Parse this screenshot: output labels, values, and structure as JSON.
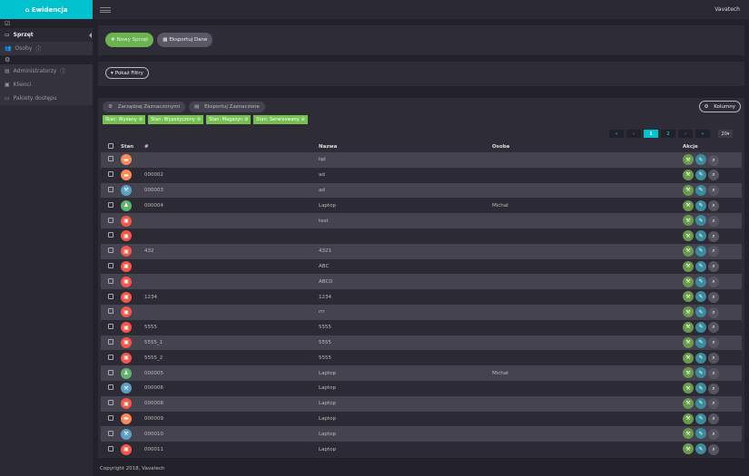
{
  "brand": {
    "title": "Ewidencja",
    "icon": "home-icon"
  },
  "topbar": {
    "user": "Vavatech"
  },
  "sidebar": {
    "items": [
      {
        "label": "Sprzęt",
        "icon": "laptop-icon"
      },
      {
        "label": "Osoby",
        "icon": "users-icon"
      },
      {
        "label": "Administratorzy",
        "icon": "id-card-icon"
      },
      {
        "label": "Klienci",
        "icon": "briefcase-icon"
      },
      {
        "label": "Pakiety dostępu",
        "icon": "credit-card-icon"
      }
    ]
  },
  "toolbar": {
    "new": "Nowy Sprzęt",
    "export": "Eksportuj Dane",
    "filters": "Pokaż Filtry"
  },
  "table_tools": {
    "manage": "Zarządzaj Zaznaczonymi",
    "export_selected": "Eksportuj Zaznaczone",
    "columns": "Kolumny"
  },
  "tags": [
    "Stan: Wydany",
    "Stan: Wypożyczony",
    "Stan: Magazyn",
    "Stan: Serwisowany"
  ],
  "pagination": {
    "pages": [
      "1",
      "2"
    ],
    "current": "1",
    "page_size": "20"
  },
  "columns": {
    "stan": "Stan",
    "num": "#",
    "nazwa": "Nazwa",
    "osoba": "Osoba",
    "akcje": "Akcje"
  },
  "status_colors": {
    "wydany": "#f98a5a",
    "serwis": "#5ea0c3",
    "wypozyczony": "#5fb56d",
    "magazyn": "#f0584c"
  },
  "rows": [
    {
      "status": "wydany",
      "num": "",
      "nazwa": "łąś",
      "osoba": ""
    },
    {
      "status": "wydany",
      "num": "000002",
      "nazwa": "ad",
      "osoba": ""
    },
    {
      "status": "serwis",
      "num": "000003",
      "nazwa": "ad",
      "osoba": ""
    },
    {
      "status": "wypozyczony",
      "num": "000004",
      "nazwa": "Laptop",
      "osoba": "Michał"
    },
    {
      "status": "magazyn",
      "num": "",
      "nazwa": "test",
      "osoba": ""
    },
    {
      "status": "magazyn",
      "num": "",
      "nazwa": "",
      "osoba": ""
    },
    {
      "status": "magazyn",
      "num": "432",
      "nazwa": "4321",
      "osoba": ""
    },
    {
      "status": "magazyn",
      "num": "",
      "nazwa": "ABC",
      "osoba": ""
    },
    {
      "status": "magazyn",
      "num": "",
      "nazwa": "ABCD",
      "osoba": ""
    },
    {
      "status": "magazyn",
      "num": "1234",
      "nazwa": "1234",
      "osoba": ""
    },
    {
      "status": "magazyn",
      "num": "",
      "nazwa": "rrr",
      "osoba": ""
    },
    {
      "status": "magazyn",
      "num": "5555",
      "nazwa": "5555",
      "osoba": ""
    },
    {
      "status": "magazyn",
      "num": "5555_1",
      "nazwa": "5555",
      "osoba": ""
    },
    {
      "status": "magazyn",
      "num": "5555_2",
      "nazwa": "5555",
      "osoba": ""
    },
    {
      "status": "wypozyczony",
      "num": "000005",
      "nazwa": "Laptop",
      "osoba": "Michał"
    },
    {
      "status": "serwis",
      "num": "000006",
      "nazwa": "Laptop",
      "osoba": ""
    },
    {
      "status": "magazyn",
      "num": "000008",
      "nazwa": "Laptop",
      "osoba": ""
    },
    {
      "status": "wydany",
      "num": "000009",
      "nazwa": "Laptop",
      "osoba": ""
    },
    {
      "status": "serwis",
      "num": "000010",
      "nazwa": "Laptop",
      "osoba": ""
    },
    {
      "status": "magazyn",
      "num": "000011",
      "nazwa": "Laptop",
      "osoba": ""
    }
  ],
  "footer": "Copyright 2018, Vavatech"
}
